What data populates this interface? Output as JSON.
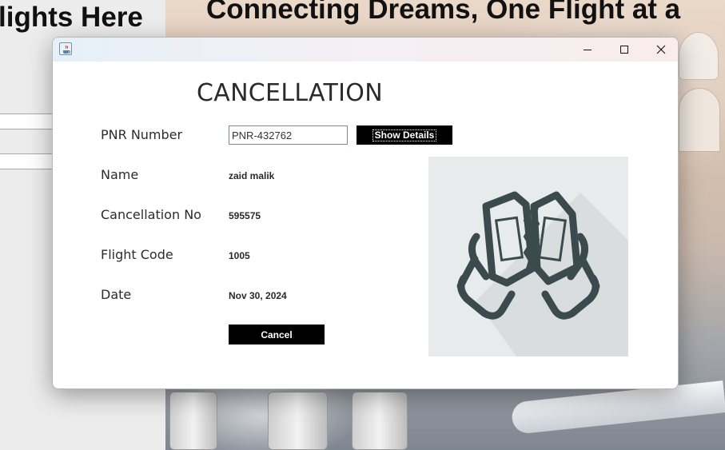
{
  "background": {
    "heading_left": "lights Here",
    "heading_right": "Connecting Dreams, One Flight at a"
  },
  "window": {
    "icon": "java-cup-icon",
    "controls": [
      "minimize-icon",
      "maximize-icon",
      "close-icon"
    ]
  },
  "form": {
    "heading": "CANCELLATION",
    "pnr_label": "PNR Number",
    "pnr_value": "PNR-432762",
    "show_details_label": "Show Details",
    "name_label": "Name",
    "name_value": "zaid malik",
    "cancellation_no_label": "Cancellation No",
    "cancellation_no_value": "595575",
    "flight_code_label": "Flight Code",
    "flight_code_value": "1005",
    "date_label": "Date",
    "date_value": "Nov 30, 2024",
    "cancel_label": "Cancel"
  },
  "illustration": {
    "icon": "torn-ticket-hands-icon",
    "colors": {
      "panel": "#e7ebeb",
      "stroke": "#3b4a4c",
      "shadow": "#d6dbdb"
    }
  }
}
